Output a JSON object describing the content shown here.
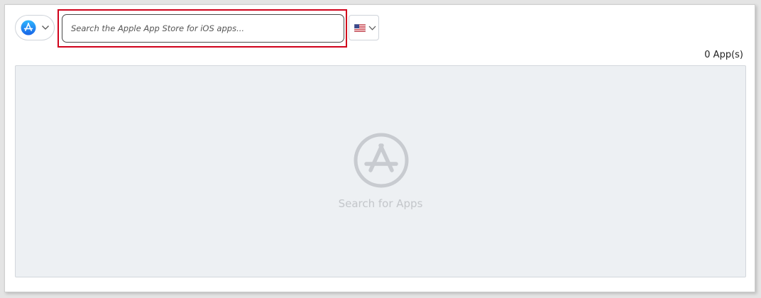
{
  "toolbar": {
    "store_icon": "app-store-icon",
    "dropdown_icon": "chevron-down-icon",
    "search": {
      "placeholder": "Search the Apple App Store for iOS apps...",
      "value": ""
    },
    "country_icon": "us-flag-icon"
  },
  "results": {
    "count_label": "0 App(s)",
    "empty_icon": "app-store-icon",
    "empty_label": "Search for Apps"
  },
  "colors": {
    "highlight": "#d0021b",
    "store_icon_blue": "#1e88f5",
    "empty_icon_gray": "#c8cbd0",
    "results_bg": "#edf0f3"
  }
}
